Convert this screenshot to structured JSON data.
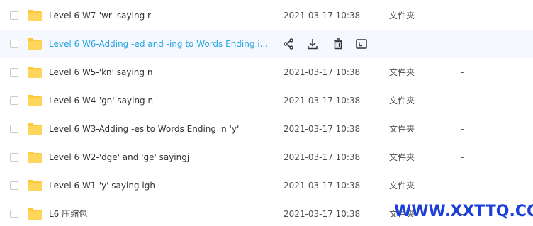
{
  "rows": [
    {
      "name": "Level 6 W7-'wr' saying r",
      "date": "2021-03-17 10:38",
      "type": "文件夹",
      "size": "-"
    },
    {
      "name": "Level 6 W6-Adding -ed and -ing to Words Ending i...",
      "date": "",
      "type": "",
      "size": ""
    },
    {
      "name": "Level 6 W5-'kn' saying n",
      "date": "2021-03-17 10:38",
      "type": "文件夹",
      "size": "-"
    },
    {
      "name": "Level 6 W4-'gn' saying n",
      "date": "2021-03-17 10:38",
      "type": "文件夹",
      "size": "-"
    },
    {
      "name": "Level 6 W3-Adding -es to Words Ending in 'y'",
      "date": "2021-03-17 10:38",
      "type": "文件夹",
      "size": "-"
    },
    {
      "name": "Level 6 W2-'dge' and 'ge' sayingj",
      "date": "2021-03-17 10:38",
      "type": "文件夹",
      "size": "-"
    },
    {
      "name": "Level 6 W1-'y' saying igh",
      "date": "2021-03-17 10:38",
      "type": "文件夹",
      "size": "-"
    },
    {
      "name": "L6 压缩包",
      "date": "2021-03-17 10:38",
      "type": "文件夹",
      "size": "-"
    }
  ],
  "hover_actions": [
    "share-icon",
    "download-icon",
    "delete-icon",
    "more-icon"
  ],
  "watermark": "WWW.XXTTQ.COM",
  "colors": {
    "folder": "#ffc93c",
    "link": "#27a6e0",
    "hover_bg": "#f5f8ff",
    "watermark": "#1d3fd8"
  }
}
